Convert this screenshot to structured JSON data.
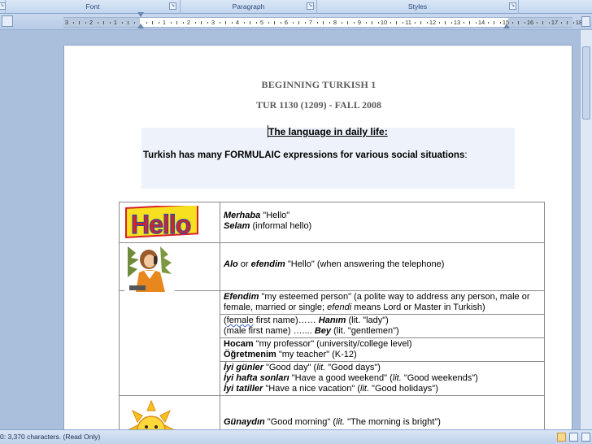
{
  "ribbon": {
    "groups": [
      {
        "label": "Font"
      },
      {
        "label": "Paragraph"
      },
      {
        "label": "Styles"
      }
    ]
  },
  "ruler": {
    "numbers": [
      "3",
      "2",
      "1",
      "1",
      "2",
      "3",
      "4",
      "5",
      "6",
      "7",
      "8",
      "9",
      "10",
      "11",
      "12",
      "13",
      "14",
      "15",
      "16",
      "17",
      "18"
    ]
  },
  "document": {
    "title": "BEGINNING TURKISH 1",
    "course": "TUR 1130 (1209) - FALL 2008",
    "heading": "The language in daily life:",
    "intro_pre": "Turkish has many FORMULAIC expressions for various social situations",
    "intro_post": ":",
    "table": {
      "row1": {
        "image": "hello-sign-clipart",
        "image_text": "Hello",
        "l1_term": "Merhaba",
        "l1_rest": " \"Hello\"",
        "l2_term": "Selam",
        "l2_rest": " (informal hello)"
      },
      "row2": {
        "image": "woman-on-telephone-clipart",
        "t1": "Alo",
        "mid": " or ",
        "t2": "efendim",
        "rest": " \"Hello\" (when answering the telephone)"
      },
      "row3": {
        "term": "Efendim",
        "rest1": " \"my esteemed person\" (a polite way to address  any person, male or female, married or single; ",
        "term2": "efendi",
        "rest2": " means Lord or Master in Turkish)"
      },
      "row4": {
        "l1_pre": "(",
        "l1_squig": "female",
        "l1_mid": " first name)…… ",
        "l1_term": "Hanım",
        "l1_rest": "    (lit. \"lady\")",
        "l2_pre": "(male first name)   ….... ",
        "l2_term": "Bey",
        "l2_rest": "      (lit. \"gentlemen\")"
      },
      "row5": {
        "l1_term": "Hocam",
        "l1_rest": "  \"my professor\"  (university/college level)",
        "l2_term": "Öğretmenim",
        "l2_rest": "  \"my teacher\" (K-12)"
      },
      "row6": {
        "l1_term": "İyi günler",
        "l1_a": " \"Good day\" (",
        "l1_lit": "lit.",
        "l1_b": " \"Good days\")",
        "l2_term": "İyi hafta sonları",
        "l2_a": " \"Have a good weekend\" (",
        "l2_lit": "lit.",
        "l2_b": " \"Good weekends\")",
        "l3_term": "İyi tatiller",
        "l3_a": " \"Have a nice vacation\" (",
        "l3_lit": "lit.",
        "l3_b": " \"Good holidays\")"
      },
      "row7": {
        "image": "smiling-sun-clipart",
        "term": "Günaydın",
        "a": " \"Good morning\" (",
        "lit": "lit.",
        "b": " \"The morning is bright\")"
      }
    }
  },
  "statusbar": {
    "text": "0: 3,370 characters.  (Read Only)"
  },
  "colors": {
    "ribbon_bg": "#c2d6ef",
    "canvas_bg": "#a9bfdc",
    "title_gray": "#5b5b5b",
    "hello_yellow": "#f6e020",
    "hello_red": "#d8202a",
    "hello_blue": "#2a4aa8"
  }
}
